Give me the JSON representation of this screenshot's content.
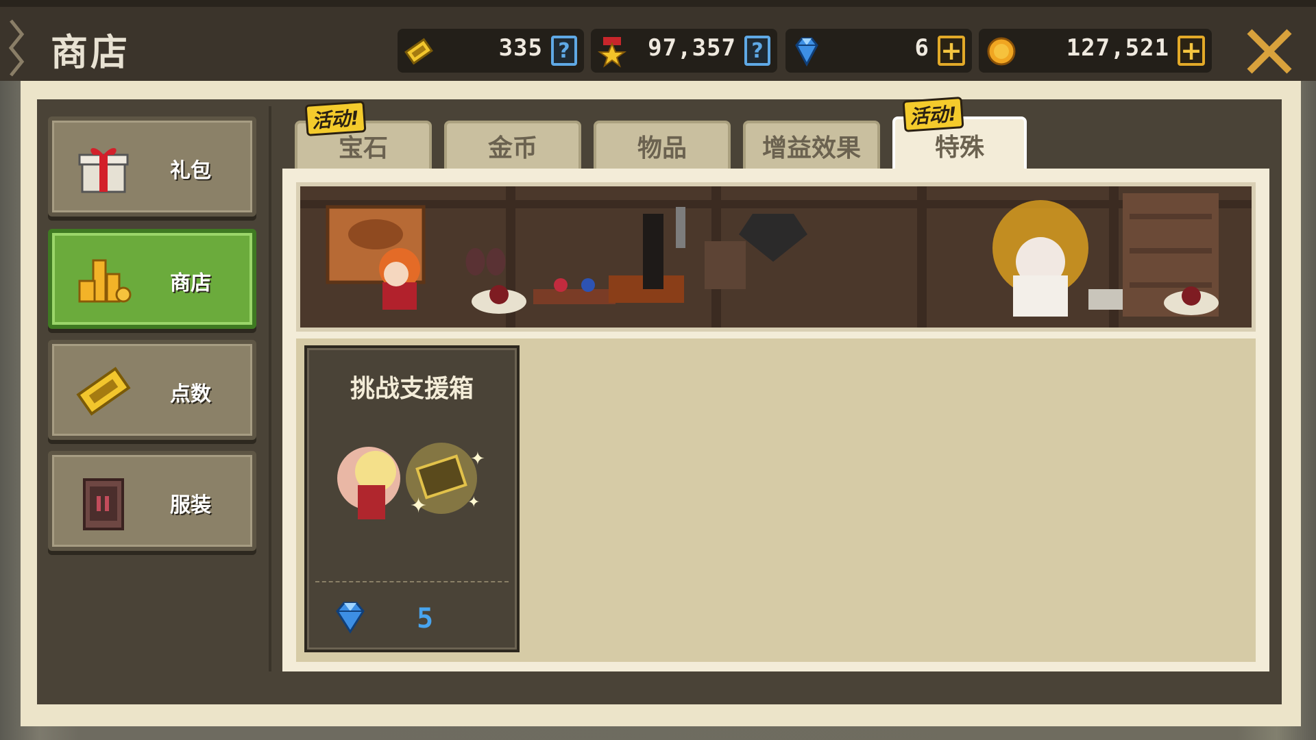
{
  "header": {
    "title": "商店"
  },
  "resources": {
    "points": {
      "value": "335",
      "icon": "ticket-icon"
    },
    "medals": {
      "value": "97,357",
      "icon": "medal-icon"
    },
    "gems": {
      "value": "6",
      "icon": "gem-icon"
    },
    "gold": {
      "value": "127,521",
      "icon": "coin-icon"
    }
  },
  "sidebar": {
    "items": [
      {
        "label": "礼包",
        "icon": "gift-icon",
        "active": false
      },
      {
        "label": "商店",
        "icon": "gold-stack-icon",
        "active": true
      },
      {
        "label": "点数",
        "icon": "ticket-icon",
        "active": false
      },
      {
        "label": "服装",
        "icon": "wardrobe-icon",
        "active": false
      }
    ]
  },
  "tabs": [
    {
      "label": "宝石",
      "badge": "活动!",
      "active": false
    },
    {
      "label": "金币",
      "badge": "",
      "active": false
    },
    {
      "label": "物品",
      "badge": "",
      "active": false
    },
    {
      "label": "增益效果",
      "badge": "",
      "active": false
    },
    {
      "label": "特殊",
      "badge": "活动!",
      "active": true
    }
  ],
  "products": [
    {
      "name": "挑战支援箱",
      "price": "5",
      "currency_icon": "gem-icon"
    }
  ],
  "colors": {
    "active_green": "#6bab3c",
    "gem_blue": "#48a4ee",
    "gold": "#e2a928"
  }
}
